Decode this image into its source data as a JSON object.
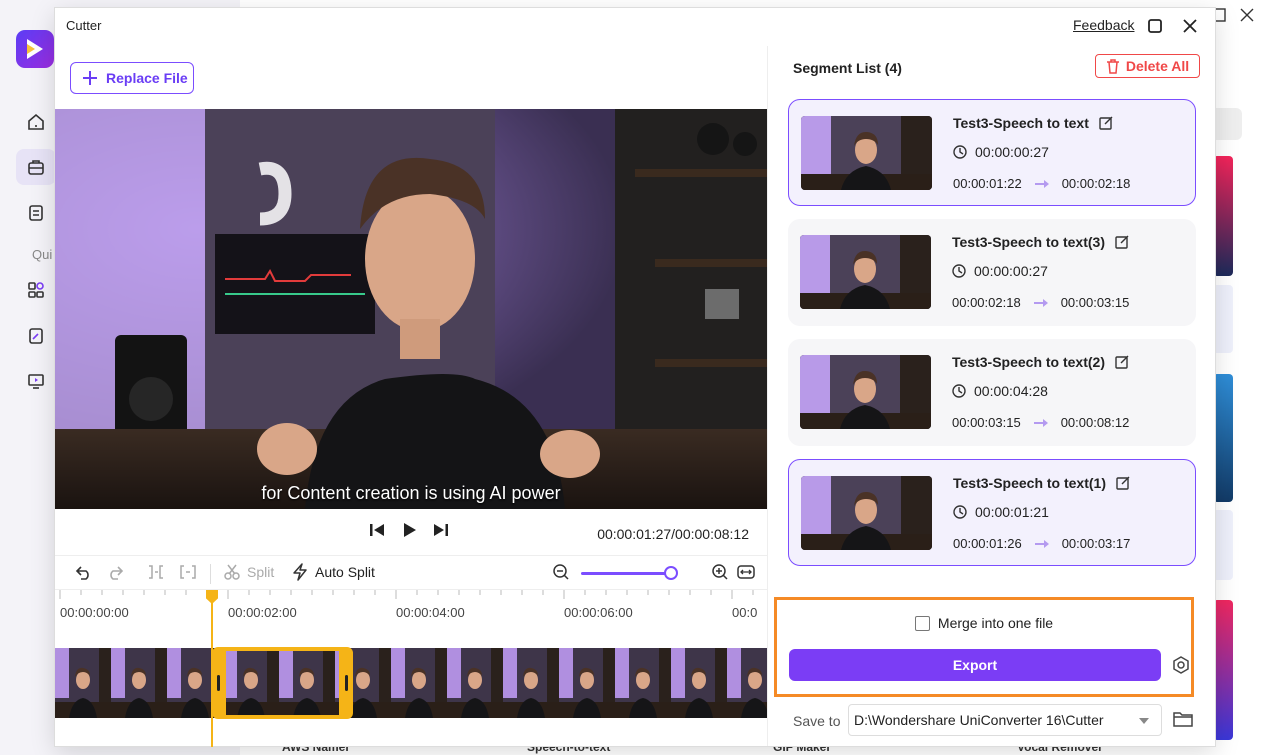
{
  "dialog": {
    "title": "Cutter",
    "feedback": "Feedback",
    "replace_file": "Replace File"
  },
  "background": {
    "quick_label": "Qui",
    "bottom_labels": [
      "AWS Namer",
      "Speech-to-text",
      "GIF Maker",
      "Vocal Remover"
    ]
  },
  "player": {
    "subtitle": "for Content creation is using AI power",
    "timecode": "00:00:01:27/00:00:08:12"
  },
  "toolbar": {
    "split": "Split",
    "auto_split": "Auto Split",
    "zoom_level": 0.9
  },
  "timeline": {
    "ruler": [
      "00:00:00:00",
      "00:00:02:00",
      "00:00:04:00",
      "00:00:06:00",
      "00:0"
    ]
  },
  "segments": {
    "title": "Segment List (4)",
    "delete_all": "Delete All",
    "items": [
      {
        "name": "Test3-Speech to text",
        "duration": "00:00:00:27",
        "start": "00:00:01:22",
        "end": "00:00:02:18",
        "selected": true
      },
      {
        "name": "Test3-Speech to text(3)",
        "duration": "00:00:00:27",
        "start": "00:00:02:18",
        "end": "00:00:03:15",
        "selected": false
      },
      {
        "name": "Test3-Speech to text(2)",
        "duration": "00:00:04:28",
        "start": "00:00:03:15",
        "end": "00:00:08:12",
        "selected": false
      },
      {
        "name": "Test3-Speech to text(1)",
        "duration": "00:00:01:21",
        "start": "00:00:01:26",
        "end": "00:00:03:17",
        "selected": true
      }
    ]
  },
  "export": {
    "merge_label": "Merge into one file",
    "merge_checked": false,
    "button": "Export",
    "save_to_label": "Save to",
    "save_path": "D:\\Wondershare UniConverter 16\\Cutter"
  },
  "colors": {
    "accent": "#7b3df5",
    "danger": "#f04848",
    "highlight": "#f58a26",
    "trim": "#f5b417"
  }
}
